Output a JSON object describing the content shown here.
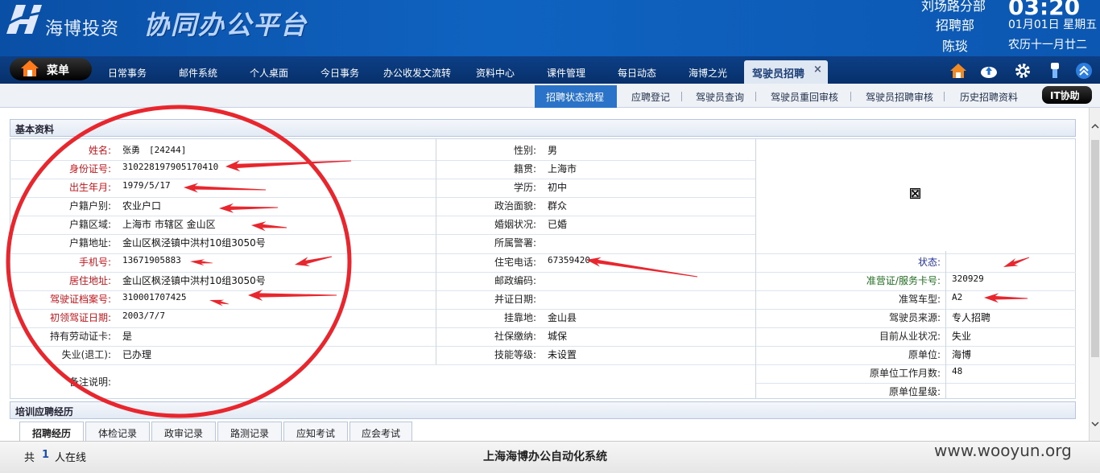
{
  "header": {
    "brand_name": "海博投资",
    "platform_title": "协同办公平台",
    "branch": "刘场路分部",
    "department": "招聘部",
    "user": "陈琰",
    "time": "03:20",
    "date": "01月01日 星期五",
    "lunar_date": "农历十一月廿二"
  },
  "nav": {
    "menu_label": "菜单",
    "items": [
      "日常事务",
      "邮件系统",
      "个人桌面",
      "今日事务",
      "办公收发文流转",
      "资料中心",
      "课件管理",
      "每日动态",
      "海博之光"
    ],
    "active_tab": "驾驶员招聘",
    "close_glyph": "×"
  },
  "subnav": {
    "active": "招聘状态流程",
    "items": [
      "应聘登记",
      "驾驶员查询",
      "驾驶员重回审核",
      "驾驶员招聘审核",
      "历史招聘资料"
    ],
    "it_help": "IT协助"
  },
  "basic": {
    "section_title": "基本资料",
    "col1": [
      {
        "label": "姓名:",
        "value": "张勇　[24244]",
        "style": "red"
      },
      {
        "label": "身份证号:",
        "value": "310228197905170410",
        "style": "red"
      },
      {
        "label": "出生年月:",
        "value": "1979/5/17",
        "style": "red"
      },
      {
        "label": "户籍户别:",
        "value": "农业户口",
        "style": "normal"
      },
      {
        "label": "户籍区域:",
        "value": "上海市 市辖区 金山区",
        "style": "normal"
      },
      {
        "label": "户籍地址:",
        "value": "金山区枫泾镇中洪村10组3050号",
        "style": "normal"
      },
      {
        "label": "手机号:",
        "value": "13671905883",
        "style": "red"
      },
      {
        "label": "居住地址:",
        "value": "金山区枫泾镇中洪村10组3050号",
        "style": "red"
      },
      {
        "label": "驾驶证档案号:",
        "value": "310001707425",
        "style": "red"
      },
      {
        "label": "初领驾证日期:",
        "value": "2003/7/7",
        "style": "red"
      },
      {
        "label": "持有劳动证卡:",
        "value": "是",
        "style": "normal"
      },
      {
        "label": "失业(退工):",
        "value": "已办理",
        "style": "normal"
      }
    ],
    "remark_label": "备注说明:",
    "col2": [
      {
        "label": "性别:",
        "value": "男"
      },
      {
        "label": "籍贯:",
        "value": "上海市"
      },
      {
        "label": "学历:",
        "value": "初中"
      },
      {
        "label": "政治面貌:",
        "value": "群众"
      },
      {
        "label": "婚姻状况:",
        "value": "已婚"
      },
      {
        "label": "所属警署:",
        "value": ""
      },
      {
        "label": "住宅电话:",
        "value": "67359420"
      },
      {
        "label": "邮政编码:",
        "value": ""
      },
      {
        "label": "并证日期:",
        "value": ""
      },
      {
        "label": "挂靠地:",
        "value": "金山县"
      },
      {
        "label": "社保缴纳:",
        "value": "城保"
      },
      {
        "label": "技能等级:",
        "value": "未设置"
      }
    ],
    "col3": [
      {
        "label": "状态:",
        "value": "",
        "style": "blue"
      },
      {
        "label": "准营证/服务卡号:",
        "value": "320929",
        "style": "green"
      },
      {
        "label": "准驾车型:",
        "value": "A2",
        "style": "normal"
      },
      {
        "label": "驾驶员来源:",
        "value": "专人招聘",
        "style": "normal"
      },
      {
        "label": "目前从业状况:",
        "value": "失业",
        "style": "normal"
      },
      {
        "label": "原单位:",
        "value": "海博",
        "style": "normal"
      },
      {
        "label": "原单位工作月数:",
        "value": "48",
        "style": "normal"
      },
      {
        "label": "原单位星级:",
        "value": "",
        "style": "normal"
      }
    ]
  },
  "training": {
    "section_title": "培训应聘经历",
    "tabs": [
      "招聘经历",
      "体检记录",
      "政审记录",
      "路测记录",
      "应知考试",
      "应会考试"
    ]
  },
  "statusbar": {
    "prefix": "共",
    "count": "1",
    "suffix": "人在线",
    "system_name": "上海海博办公自动化系统",
    "watermark": "www.wooyun.org"
  },
  "colors": {
    "header_blue": "#0f63c0",
    "label_red": "#c4161c",
    "annotation_red": "#e8262e",
    "active_subnav": "#2b73c8"
  }
}
